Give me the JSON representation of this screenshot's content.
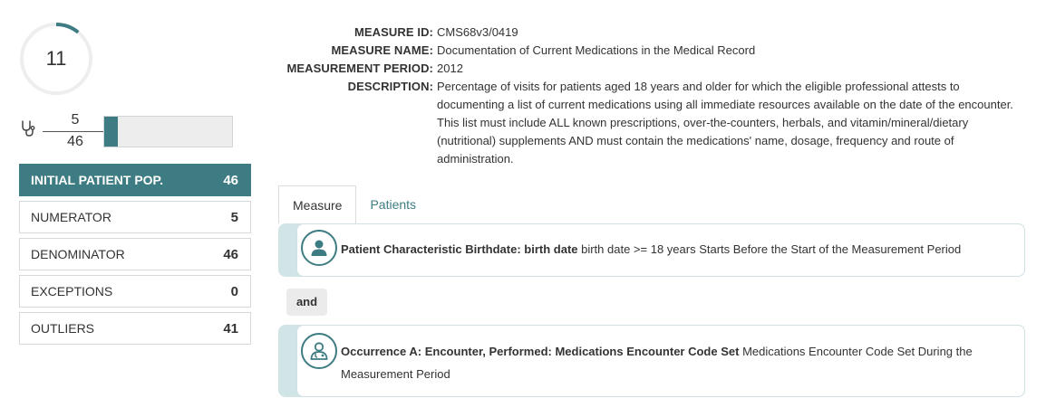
{
  "summary": {
    "performance_value": "11",
    "performance_fraction": 0.11,
    "numerator": "5",
    "denominator": "46",
    "progress_fraction": 0.109
  },
  "populations": [
    {
      "label": "INITIAL PATIENT POP.",
      "count": "46",
      "active": true
    },
    {
      "label": "NUMERATOR",
      "count": "5",
      "active": false
    },
    {
      "label": "DENOMINATOR",
      "count": "46",
      "active": false
    },
    {
      "label": "EXCEPTIONS",
      "count": "0",
      "active": false
    },
    {
      "label": "OUTLIERS",
      "count": "41",
      "active": false
    }
  ],
  "measure": {
    "id_label": "MEASURE ID:",
    "id": "CMS68v3/0419",
    "name_label": "MEASURE NAME:",
    "name": "Documentation of Current Medications in the Medical Record",
    "period_label": "MEASUREMENT PERIOD:",
    "period": "2012",
    "description_label": "DESCRIPTION:",
    "description": "Percentage of visits for patients aged 18 years and older for which the eligible professional attests to documenting a list of current medications using all immediate resources available on the date of the encounter. This list must include ALL known prescriptions, over-the-counters, herbals, and vitamin/mineral/dietary (nutritional) supplements AND must contain the medications' name, dosage, frequency and route of administration."
  },
  "tabs": [
    {
      "label": "Measure",
      "active": true
    },
    {
      "label": "Patients",
      "active": false
    }
  ],
  "criteria": {
    "first_title": "Patient Characteristic Birthdate: birth date",
    "first_text": " birth date >= 18 years Starts Before the Start of the Measurement Period",
    "conjunction": "and",
    "second_title": "Occurrence A: Encounter, Performed: Medications Encounter Code Set",
    "second_text": " Medications Encounter Code Set During the Measurement Period"
  },
  "colors": {
    "accent": "#3e7c83",
    "criteria_band": "#d1e4e6",
    "progress_track": "#ededed"
  },
  "icons": {
    "stethoscope": "stethoscope-icon",
    "patient": "patient-icon",
    "doctor": "doctor-icon"
  }
}
